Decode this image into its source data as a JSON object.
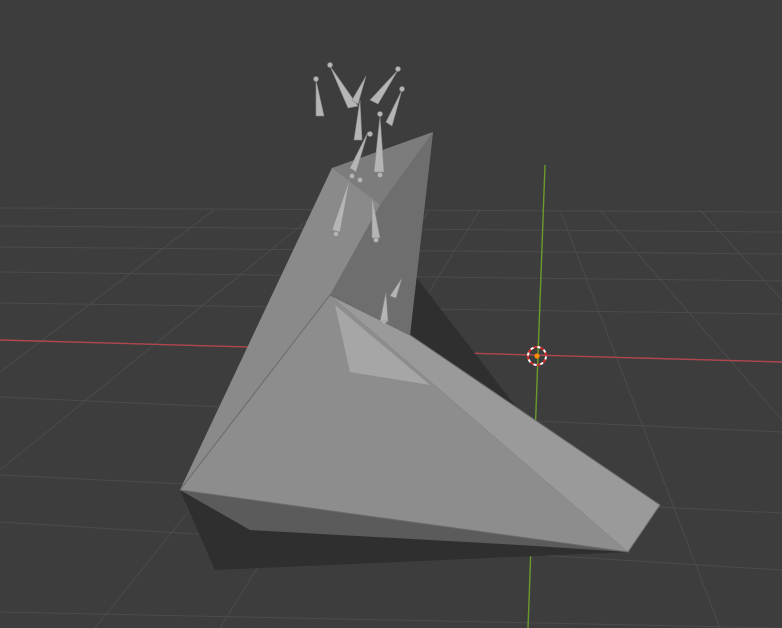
{
  "viewport": {
    "name": "3D Viewport",
    "background": "#3d3d3d",
    "grid_color": "#4a4a4a",
    "x_axis_color": "#b0474e",
    "y_axis_color": "#6b9a2c",
    "mesh_color": "#8f8f8f",
    "armature_color": "#b5b5b5",
    "origin_color": "#ff8a00"
  },
  "scene": {
    "objects": [
      {
        "type": "mesh",
        "label": ""
      },
      {
        "type": "armature",
        "label": ""
      }
    ],
    "origin_marker": "3d-cursor-icon"
  }
}
